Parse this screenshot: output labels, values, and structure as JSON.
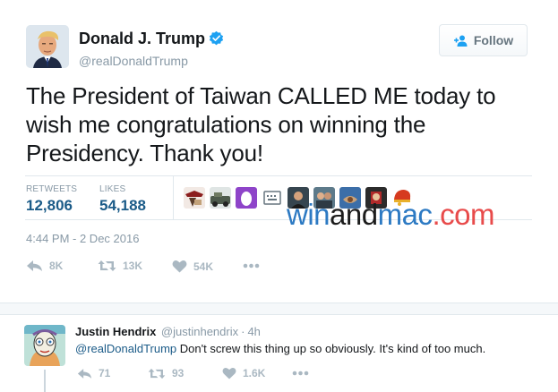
{
  "tweet": {
    "author": {
      "name": "Donald J. Trump",
      "handle": "@realDonaldTrump",
      "verified": true
    },
    "follow_label": "Follow",
    "text": "The President of Taiwan CALLED ME today to wish me congratulations on winning the Presidency. Thank you!",
    "stats": {
      "retweets_label": "RETWEETS",
      "retweets": "12,806",
      "likes_label": "LIKES",
      "likes": "54,188"
    },
    "liker_avatar_count": 9,
    "timestamp": "4:44 PM - 2 Dec 2016",
    "actions": {
      "reply_count": "8K",
      "retweet_count": "13K",
      "like_count": "54K"
    }
  },
  "watermark": {
    "part1": "win",
    "part2": "and",
    "part3": "mac",
    "part4": ".com"
  },
  "reply": {
    "author": {
      "name": "Justin Hendrix",
      "handle": "@justinhendrix"
    },
    "separator": "·",
    "time": "4h",
    "mention": "@realDonaldTrump",
    "text": " Don't screw this thing up so obviously. It's kind of too much.",
    "actions": {
      "reply_count": "71",
      "retweet_count": "93",
      "like_count": "1.6K"
    }
  },
  "colors": {
    "link_blue": "#1b5b88",
    "muted_gray": "#8899a6",
    "icon_gray": "#aab8c2",
    "verified_blue": "#1da1f2",
    "watermark_blue": "#2d7ac3",
    "watermark_red": "#e84b4b"
  },
  "icons": {
    "verified": "verified-badge-icon",
    "follow": "add-person-icon",
    "reply": "reply-arrow-icon",
    "retweet": "retweet-icon",
    "like": "heart-icon",
    "more": "more-dots-icon"
  }
}
